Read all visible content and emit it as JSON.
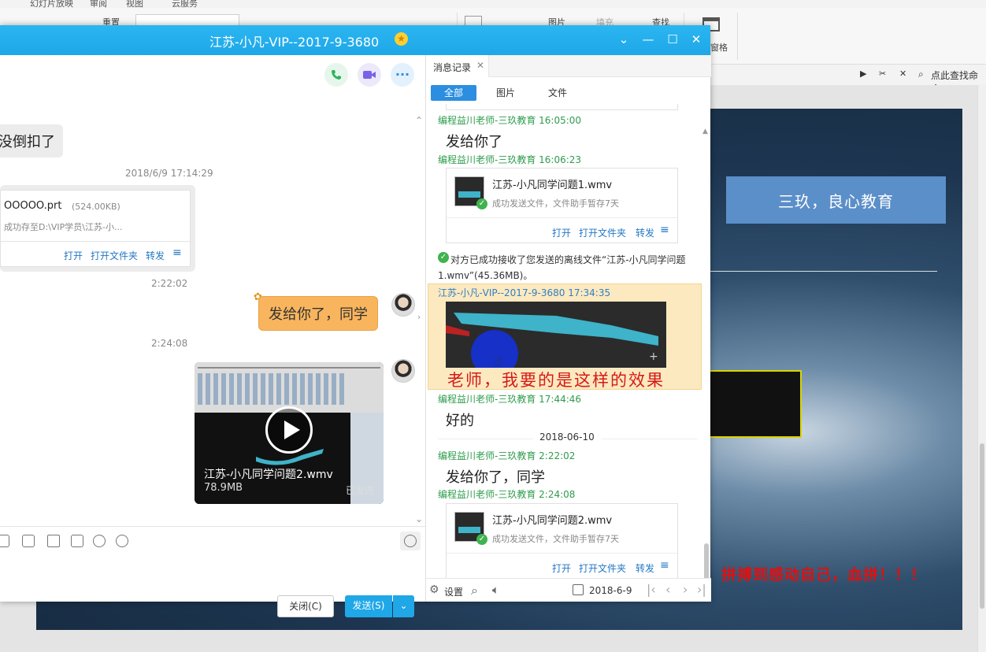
{
  "ppt": {
    "menu": [
      "幻灯片放映",
      "审阅",
      "视图",
      "云服务"
    ],
    "ribbon": {
      "rearrange": "重置",
      "picture": "图片",
      "fill": "填充",
      "find": "查找",
      "pane": "窗格"
    },
    "subbar": {
      "find_cmd": "点此查找命令"
    },
    "slide": {
      "title": "三玖，良心教育",
      "slogan": "拼搏到感动自己，血拼！！！"
    }
  },
  "window": {
    "title": "江苏-小凡-VIP--2017-9-3680",
    "buttons": {
      "close": "关闭(C)",
      "send": "发送(S)"
    }
  },
  "chat": {
    "partial_msg": "没倒扣了",
    "ts1": "2018/6/9 17:14:29",
    "file": {
      "name": "OOOOO.prt",
      "size": "(524.00KB)",
      "status": "成功存至D:\\VIP学员\\江苏-小...",
      "actions": [
        "打开",
        "打开文件夹",
        "转发"
      ]
    },
    "ts2": "2:22:02",
    "my_msg": "发给你了，同学",
    "ts3": "2:24:08",
    "video": {
      "name": "江苏-小凡同学问题2.wmv",
      "size": "78.9MB",
      "status": "已发送"
    }
  },
  "history": {
    "tab_label": "消息记录",
    "filters": [
      "全部",
      "图片",
      "文件"
    ],
    "entries": {
      "s1": "编程益川老师-三玖教育 16:05:00",
      "m1": "发给你了",
      "s2": "编程益川老师-三玖教育 16:06:23",
      "file1": {
        "name": "江苏-小凡同学问题1.wmv",
        "status": "成功发送文件，文件助手暂存7天"
      },
      "file_actions": [
        "打开",
        "打开文件夹",
        "转发"
      ],
      "sys": "对方已成功接收了您发送的离线文件“江苏-小凡同学问题1.wmv”(45.36MB)。",
      "s3": "江苏-小凡-VIP--2017-9-3680 17:34:35",
      "caption": "老师，我要的是这样的效果",
      "s4": "编程益川老师-三玖教育 17:44:46",
      "m4": "好的",
      "date_sep": "2018-06-10",
      "s5": "编程益川老师-三玖教育 2:22:02",
      "m5": "发给你了，同学",
      "s6": "编程益川老师-三玖教育 2:24:08",
      "file2": {
        "name": "江苏-小凡同学问题2.wmv",
        "status": "成功发送文件，文件助手暂存7天"
      }
    },
    "bottom": {
      "settings": "设置",
      "date": "2018-6-9"
    }
  }
}
